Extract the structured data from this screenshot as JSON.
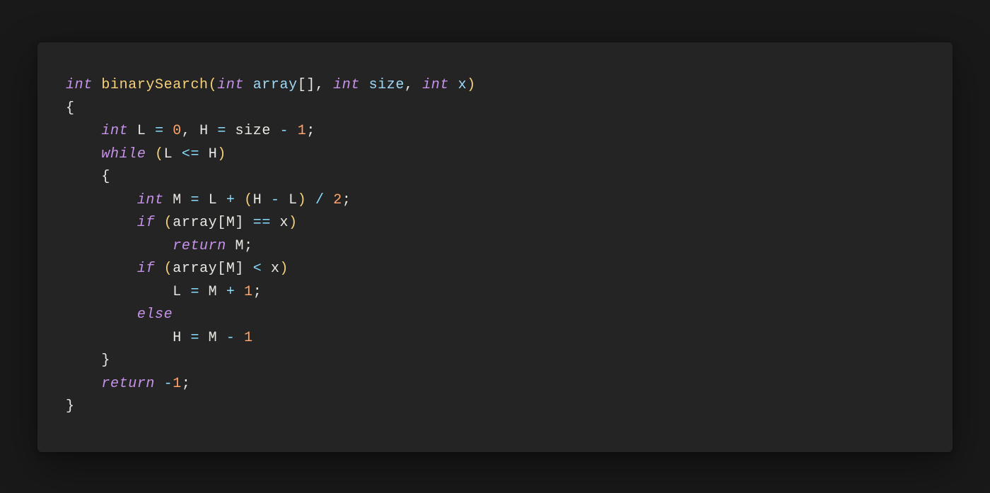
{
  "code": {
    "language": "c",
    "lines": [
      [
        {
          "c": "type",
          "t": "int"
        },
        {
          "c": "sp",
          "t": " "
        },
        {
          "c": "func",
          "t": "binarySearch"
        },
        {
          "c": "paren",
          "t": "("
        },
        {
          "c": "type",
          "t": "int"
        },
        {
          "c": "sp",
          "t": " "
        },
        {
          "c": "param",
          "t": "array"
        },
        {
          "c": "bracket",
          "t": "[]"
        },
        {
          "c": "punc",
          "t": ","
        },
        {
          "c": "sp",
          "t": " "
        },
        {
          "c": "type",
          "t": "int"
        },
        {
          "c": "sp",
          "t": " "
        },
        {
          "c": "param",
          "t": "size"
        },
        {
          "c": "punc",
          "t": ","
        },
        {
          "c": "sp",
          "t": " "
        },
        {
          "c": "type",
          "t": "int"
        },
        {
          "c": "sp",
          "t": " "
        },
        {
          "c": "param",
          "t": "x"
        },
        {
          "c": "paren",
          "t": ")"
        }
      ],
      [
        {
          "c": "punc",
          "t": "{"
        }
      ],
      [
        {
          "c": "sp",
          "t": "    "
        },
        {
          "c": "type",
          "t": "int"
        },
        {
          "c": "sp",
          "t": " "
        },
        {
          "c": "var",
          "t": "L"
        },
        {
          "c": "sp",
          "t": " "
        },
        {
          "c": "op",
          "t": "="
        },
        {
          "c": "sp",
          "t": " "
        },
        {
          "c": "num",
          "t": "0"
        },
        {
          "c": "punc",
          "t": ","
        },
        {
          "c": "sp",
          "t": " "
        },
        {
          "c": "var",
          "t": "H"
        },
        {
          "c": "sp",
          "t": " "
        },
        {
          "c": "op",
          "t": "="
        },
        {
          "c": "sp",
          "t": " "
        },
        {
          "c": "var",
          "t": "size"
        },
        {
          "c": "sp",
          "t": " "
        },
        {
          "c": "op",
          "t": "-"
        },
        {
          "c": "sp",
          "t": " "
        },
        {
          "c": "num",
          "t": "1"
        },
        {
          "c": "punc",
          "t": ";"
        }
      ],
      [
        {
          "c": "sp",
          "t": "    "
        },
        {
          "c": "kw",
          "t": "while"
        },
        {
          "c": "sp",
          "t": " "
        },
        {
          "c": "paren",
          "t": "("
        },
        {
          "c": "var",
          "t": "L"
        },
        {
          "c": "sp",
          "t": " "
        },
        {
          "c": "op",
          "t": "<="
        },
        {
          "c": "sp",
          "t": " "
        },
        {
          "c": "var",
          "t": "H"
        },
        {
          "c": "paren",
          "t": ")"
        }
      ],
      [
        {
          "c": "sp",
          "t": "    "
        },
        {
          "c": "punc",
          "t": "{"
        }
      ],
      [
        {
          "c": "sp",
          "t": "        "
        },
        {
          "c": "type",
          "t": "int"
        },
        {
          "c": "sp",
          "t": " "
        },
        {
          "c": "var",
          "t": "M"
        },
        {
          "c": "sp",
          "t": " "
        },
        {
          "c": "op",
          "t": "="
        },
        {
          "c": "sp",
          "t": " "
        },
        {
          "c": "var",
          "t": "L"
        },
        {
          "c": "sp",
          "t": " "
        },
        {
          "c": "op",
          "t": "+"
        },
        {
          "c": "sp",
          "t": " "
        },
        {
          "c": "paren",
          "t": "("
        },
        {
          "c": "var",
          "t": "H"
        },
        {
          "c": "sp",
          "t": " "
        },
        {
          "c": "op",
          "t": "-"
        },
        {
          "c": "sp",
          "t": " "
        },
        {
          "c": "var",
          "t": "L"
        },
        {
          "c": "paren",
          "t": ")"
        },
        {
          "c": "sp",
          "t": " "
        },
        {
          "c": "op",
          "t": "/"
        },
        {
          "c": "sp",
          "t": " "
        },
        {
          "c": "num",
          "t": "2"
        },
        {
          "c": "punc",
          "t": ";"
        }
      ],
      [
        {
          "c": "sp",
          "t": "        "
        },
        {
          "c": "kw",
          "t": "if"
        },
        {
          "c": "sp",
          "t": " "
        },
        {
          "c": "paren",
          "t": "("
        },
        {
          "c": "var",
          "t": "array"
        },
        {
          "c": "bracket",
          "t": "["
        },
        {
          "c": "var",
          "t": "M"
        },
        {
          "c": "bracket",
          "t": "]"
        },
        {
          "c": "sp",
          "t": " "
        },
        {
          "c": "op",
          "t": "=="
        },
        {
          "c": "sp",
          "t": " "
        },
        {
          "c": "var",
          "t": "x"
        },
        {
          "c": "paren",
          "t": ")"
        }
      ],
      [
        {
          "c": "sp",
          "t": "            "
        },
        {
          "c": "kw",
          "t": "return"
        },
        {
          "c": "sp",
          "t": " "
        },
        {
          "c": "var",
          "t": "M"
        },
        {
          "c": "punc",
          "t": ";"
        }
      ],
      [
        {
          "c": "sp",
          "t": "        "
        },
        {
          "c": "kw",
          "t": "if"
        },
        {
          "c": "sp",
          "t": " "
        },
        {
          "c": "paren",
          "t": "("
        },
        {
          "c": "var",
          "t": "array"
        },
        {
          "c": "bracket",
          "t": "["
        },
        {
          "c": "var",
          "t": "M"
        },
        {
          "c": "bracket",
          "t": "]"
        },
        {
          "c": "sp",
          "t": " "
        },
        {
          "c": "op",
          "t": "<"
        },
        {
          "c": "sp",
          "t": " "
        },
        {
          "c": "var",
          "t": "x"
        },
        {
          "c": "paren",
          "t": ")"
        }
      ],
      [
        {
          "c": "sp",
          "t": "            "
        },
        {
          "c": "var",
          "t": "L"
        },
        {
          "c": "sp",
          "t": " "
        },
        {
          "c": "op",
          "t": "="
        },
        {
          "c": "sp",
          "t": " "
        },
        {
          "c": "var",
          "t": "M"
        },
        {
          "c": "sp",
          "t": " "
        },
        {
          "c": "op",
          "t": "+"
        },
        {
          "c": "sp",
          "t": " "
        },
        {
          "c": "num",
          "t": "1"
        },
        {
          "c": "punc",
          "t": ";"
        }
      ],
      [
        {
          "c": "sp",
          "t": "        "
        },
        {
          "c": "kw",
          "t": "else"
        }
      ],
      [
        {
          "c": "sp",
          "t": "            "
        },
        {
          "c": "var",
          "t": "H"
        },
        {
          "c": "sp",
          "t": " "
        },
        {
          "c": "op",
          "t": "="
        },
        {
          "c": "sp",
          "t": " "
        },
        {
          "c": "var",
          "t": "M"
        },
        {
          "c": "sp",
          "t": " "
        },
        {
          "c": "op",
          "t": "-"
        },
        {
          "c": "sp",
          "t": " "
        },
        {
          "c": "num",
          "t": "1"
        }
      ],
      [
        {
          "c": "sp",
          "t": "    "
        },
        {
          "c": "punc",
          "t": "}"
        }
      ],
      [
        {
          "c": "sp",
          "t": "    "
        },
        {
          "c": "kw",
          "t": "return"
        },
        {
          "c": "sp",
          "t": " "
        },
        {
          "c": "op",
          "t": "-"
        },
        {
          "c": "num",
          "t": "1"
        },
        {
          "c": "punc",
          "t": ";"
        }
      ],
      [
        {
          "c": "punc",
          "t": "}"
        }
      ]
    ]
  },
  "colors": {
    "background_outer": "#191919",
    "background_card": "#242424",
    "type_keyword": "#c792ea",
    "function_name": "#f7d07a",
    "parameter": "#9fd7f5",
    "number": "#ffa26b",
    "operator": "#89ddff",
    "default_text": "#e8e8e3"
  }
}
